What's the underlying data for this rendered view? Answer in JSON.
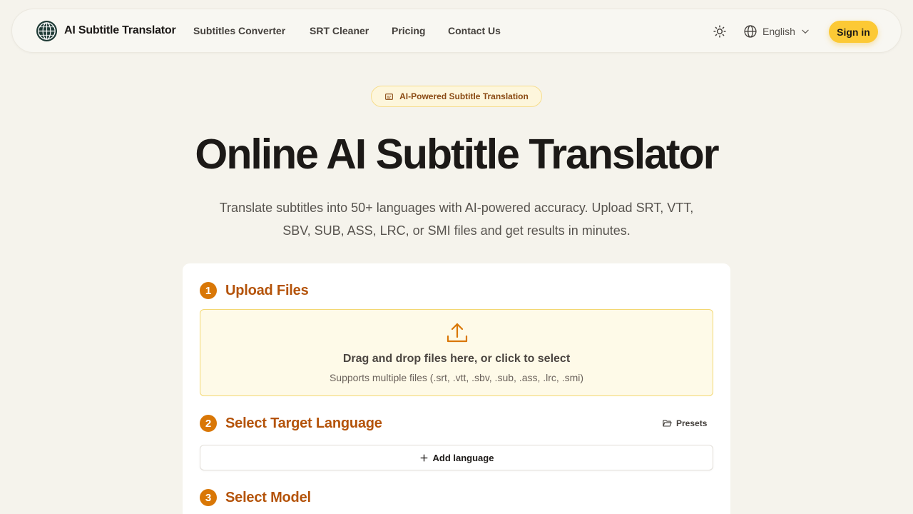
{
  "header": {
    "brand": "AI Subtitle Translator",
    "nav": [
      {
        "label": "Subtitles Converter"
      },
      {
        "label": "SRT Cleaner"
      },
      {
        "label": "Pricing"
      },
      {
        "label": "Contact Us"
      }
    ],
    "language": "English",
    "sign_in": "Sign in",
    "icons": {
      "theme": "sun-icon",
      "language": "globe-icon",
      "chevron": "chevron-down-icon",
      "logo": "globe-logo-icon"
    }
  },
  "hero": {
    "badge": "AI-Powered Subtitle Translation",
    "title": "Online AI Subtitle Translator",
    "subtitle": "Translate subtitles into 50+ languages with AI-powered accuracy. Upload SRT, VTT, SBV, SUB, ASS, LRC, or SMI files and get results in minutes."
  },
  "steps": [
    {
      "number": "1",
      "title": "Upload Files"
    },
    {
      "number": "2",
      "title": "Select Target Language"
    },
    {
      "number": "3",
      "title": "Select Model"
    }
  ],
  "upload": {
    "main_text": "Drag and drop files here, or click to select",
    "sub_text": "Supports multiple files (.srt, .vtt, .sbv, .sub, .ass, .lrc, .smi)"
  },
  "language_section": {
    "presets": "Presets",
    "add_language": "Add language"
  },
  "colors": {
    "background": "#f5f3ec",
    "accent": "#fcc935",
    "step": "#d97706",
    "step_title": "#b45309"
  }
}
